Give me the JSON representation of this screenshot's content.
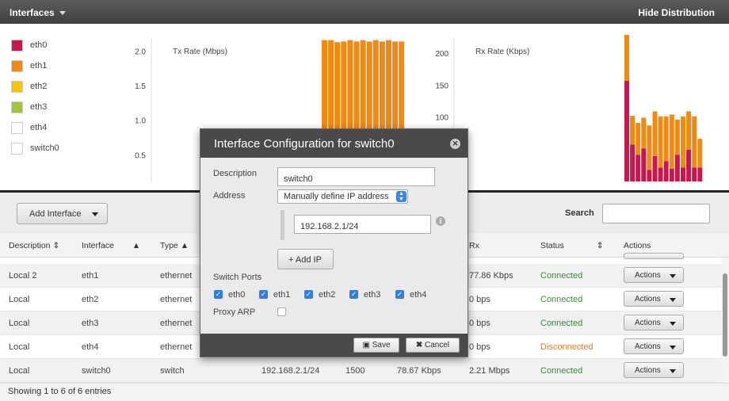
{
  "topbar": {
    "title": "Interfaces",
    "hide_label": "Hide Distribution"
  },
  "legend": [
    {
      "name": "eth0",
      "color": "#c8174d"
    },
    {
      "name": "eth1",
      "color": "#f08a15"
    },
    {
      "name": "eth2",
      "color": "#f7c600"
    },
    {
      "name": "eth3",
      "color": "#a3c43a"
    },
    {
      "name": "eth4",
      "color": "#ffffff"
    },
    {
      "name": "switch0",
      "color": "#ffffff"
    }
  ],
  "chart_data": [
    {
      "type": "bar",
      "title": "Tx Rate (Mbps)",
      "yticks": [
        "2.0",
        "1.5",
        "1.0",
        "0.5"
      ],
      "ylim": [
        0,
        2.2
      ],
      "series": [
        {
          "name": "eth1",
          "values": [
            2.17,
            2.17,
            2.14,
            2.15,
            2.17,
            2.15,
            2.17,
            2.15,
            2.17,
            2.15,
            2.17,
            2.15,
            2.15
          ]
        }
      ]
    },
    {
      "type": "bar",
      "stacked": true,
      "title": "Rx Rate (Kbps)",
      "yticks": [
        "200",
        "150",
        "100"
      ],
      "ylim": [
        0,
        225
      ],
      "series": [
        {
          "name": "eth0",
          "values": [
            158,
            58,
            42,
            52,
            18,
            40,
            22,
            32,
            20,
            42,
            22,
            50,
            22,
            22
          ]
        },
        {
          "name": "eth1",
          "values": [
            72,
            45,
            50,
            48,
            70,
            70,
            80,
            70,
            85,
            55,
            80,
            60,
            80,
            45
          ]
        }
      ]
    }
  ],
  "toolbar": {
    "add_label": "Add Interface",
    "search_label": "Search",
    "search_value": ""
  },
  "table": {
    "columns": [
      "Description",
      "Interface",
      "Type",
      "Rx",
      "Status",
      "Actions"
    ],
    "rows": [
      {
        "desc": "Local 2",
        "iface": "eth1",
        "type": "ethernet",
        "addr": "",
        "mtu": "",
        "tx": "",
        "rx": "77.86 Kbps",
        "status": "Connected",
        "ok": true
      },
      {
        "desc": "Local",
        "iface": "eth2",
        "type": "ethernet",
        "addr": "",
        "mtu": "",
        "tx": "",
        "rx": "0 bps",
        "status": "Connected",
        "ok": true
      },
      {
        "desc": "Local",
        "iface": "eth3",
        "type": "ethernet",
        "addr": "",
        "mtu": "",
        "tx": "",
        "rx": "0 bps",
        "status": "Connected",
        "ok": true
      },
      {
        "desc": "Local",
        "iface": "eth4",
        "type": "ethernet",
        "addr": "",
        "mtu": "",
        "tx": "",
        "rx": "0 bps",
        "status": "Disconnected",
        "ok": false
      },
      {
        "desc": "Local",
        "iface": "switch0",
        "type": "switch",
        "addr": "192.168.2.1/24",
        "mtu": "1500",
        "tx": "78.67 Kbps",
        "rx": "2.21 Mbps",
        "status": "Connected",
        "ok": true
      }
    ],
    "actions_label": "Actions",
    "footer": "Showing 1 to 6 of 6 entries"
  },
  "modal": {
    "title": "Interface Configuration for switch0",
    "description_label": "Description",
    "description_value": "switch0",
    "address_label": "Address",
    "address_mode": "Manually define IP address",
    "ip_value": "192.168.2.1/24",
    "add_ip_label": "Add IP",
    "switch_ports_label": "Switch Ports",
    "ports": [
      {
        "name": "eth0",
        "checked": true
      },
      {
        "name": "eth1",
        "checked": true
      },
      {
        "name": "eth2",
        "checked": true
      },
      {
        "name": "eth3",
        "checked": true
      },
      {
        "name": "eth4",
        "checked": true
      }
    ],
    "proxy_arp_label": "Proxy ARP",
    "proxy_arp_checked": false,
    "save_label": "Save",
    "cancel_label": "Cancel"
  }
}
